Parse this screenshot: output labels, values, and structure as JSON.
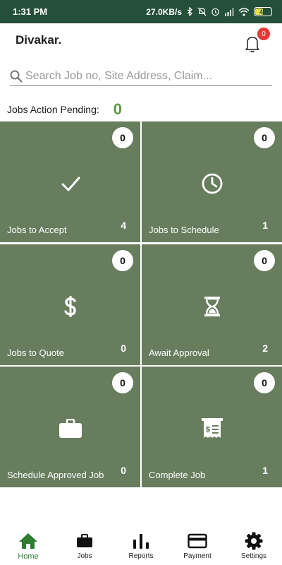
{
  "status_bar": {
    "time": "1:31 PM",
    "network_speed": "27.0KB/s",
    "battery": "46",
    "icons": [
      "bluetooth-icon",
      "mute-icon",
      "alarm-icon",
      "signal-icon",
      "wifi-icon",
      "battery-icon"
    ]
  },
  "header": {
    "user_name": "Divakar.",
    "notification_count": "0"
  },
  "search": {
    "placeholder": "Search Job no, Site Address, Claim..."
  },
  "pending": {
    "label": "Jobs Action Pending:",
    "count": "0"
  },
  "tiles": [
    {
      "title": "Jobs to Accept",
      "badge": "0",
      "count": "4",
      "icon": "checkmark-icon"
    },
    {
      "title": "Jobs to Schedule",
      "badge": "0",
      "count": "1",
      "icon": "clock-icon"
    },
    {
      "title": "Jobs to Quote",
      "badge": "0",
      "count": "0",
      "icon": "dollar-icon"
    },
    {
      "title": "Await Approval",
      "badge": "0",
      "count": "2",
      "icon": "hourglass-icon"
    },
    {
      "title": "Schedule Approved Job",
      "badge": "0",
      "count": "0",
      "icon": "briefcase-icon"
    },
    {
      "title": "Complete Job",
      "badge": "0",
      "count": "1",
      "icon": "receipt-icon"
    }
  ],
  "bottom_nav": [
    {
      "label": "Home",
      "icon": "home-icon",
      "active": true
    },
    {
      "label": "Jobs",
      "icon": "briefcase-icon",
      "active": false
    },
    {
      "label": "Reports",
      "icon": "bar-chart-icon",
      "active": false
    },
    {
      "label": "Payment",
      "icon": "credit-card-icon",
      "active": false
    },
    {
      "label": "Settings",
      "icon": "gear-icon",
      "active": false
    }
  ],
  "colors": {
    "status_bar": "#244f39",
    "tile": "#677d5d",
    "accent_green": "#5c9a3a",
    "nav_active": "#2e7d32",
    "badge_red": "#e53935"
  }
}
